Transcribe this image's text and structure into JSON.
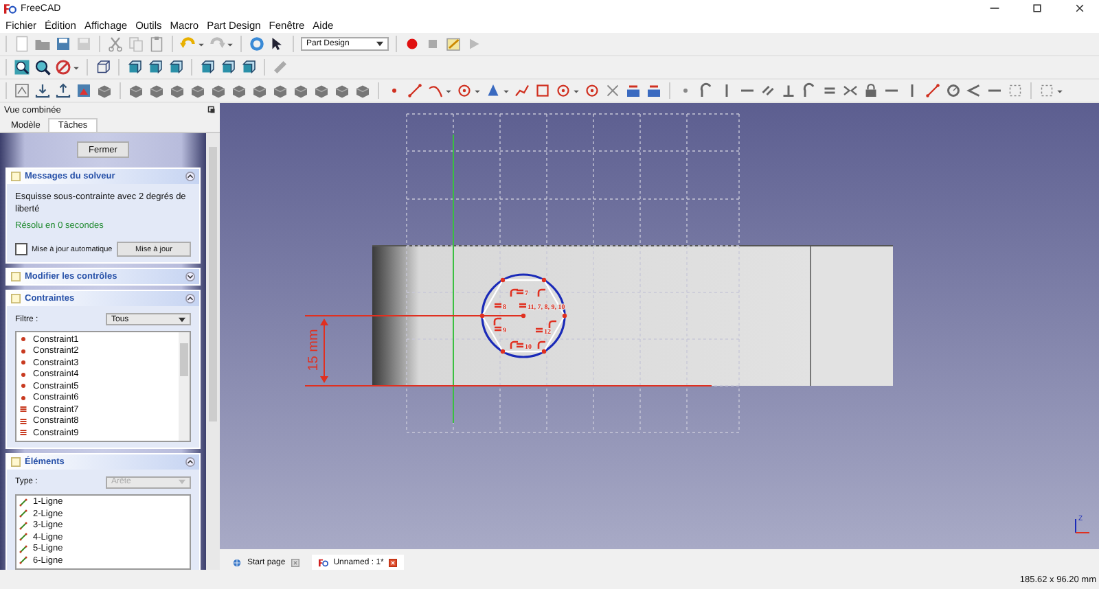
{
  "window": {
    "title": "FreeCAD"
  },
  "menu": [
    "Fichier",
    "Édition",
    "Affichage",
    "Outils",
    "Macro",
    "Part Design",
    "Fenêtre",
    "Aide"
  ],
  "workbench": "Part Design",
  "combo_view": {
    "title": "Vue combinée",
    "tabs": [
      {
        "label": "Modèle",
        "selected": false
      },
      {
        "label": "Tâches",
        "selected": true
      }
    ]
  },
  "tasks": {
    "close_button": "Fermer",
    "sections": [
      {
        "kind": "solver",
        "title": "Messages du solveur",
        "expanded": true,
        "message": "Esquisse sous-contrainte avec 2 degrés de liberté",
        "result": "Résolu en 0 secondes",
        "auto_update": {
          "label": "Mise à jour automatique",
          "checked": false
        },
        "update_button": "Mise à jour"
      },
      {
        "title": "Modifier les contrôles",
        "expanded": false
      },
      {
        "kind": "constraints",
        "title": "Contraintes",
        "expanded": true,
        "filter_label": "Filtre :",
        "filter_value": "Tous",
        "items": [
          {
            "name": "Constraint1",
            "kind": "point"
          },
          {
            "name": "Constraint2",
            "kind": "point"
          },
          {
            "name": "Constraint3",
            "kind": "point"
          },
          {
            "name": "Constraint4",
            "kind": "point"
          },
          {
            "name": "Constraint5",
            "kind": "point"
          },
          {
            "name": "Constraint6",
            "kind": "point"
          },
          {
            "name": "Constraint7",
            "kind": "equal"
          },
          {
            "name": "Constraint8",
            "kind": "equal"
          },
          {
            "name": "Constraint9",
            "kind": "equal"
          }
        ]
      },
      {
        "kind": "elements",
        "title": "Éléments",
        "expanded": true,
        "type_label": "Type :",
        "type_value": "Arête",
        "type_disabled": true,
        "items": [
          "1-Ligne",
          "2-Ligne",
          "3-Ligne",
          "4-Ligne",
          "5-Ligne",
          "6-Ligne"
        ]
      }
    ]
  },
  "view": {
    "dimension": "15 mm",
    "constraint_labels": [
      "7",
      "8",
      "11, 7, 8, 9, 10",
      "9",
      "12",
      "10"
    ],
    "axis_label": "Z"
  },
  "doc_tabs": [
    {
      "label": "Start page",
      "kind": "web",
      "selected": false
    },
    {
      "label": "Unnamed : 1*",
      "kind": "doc",
      "selected": true
    }
  ],
  "status_bar": "185.62 x 96.20 mm"
}
